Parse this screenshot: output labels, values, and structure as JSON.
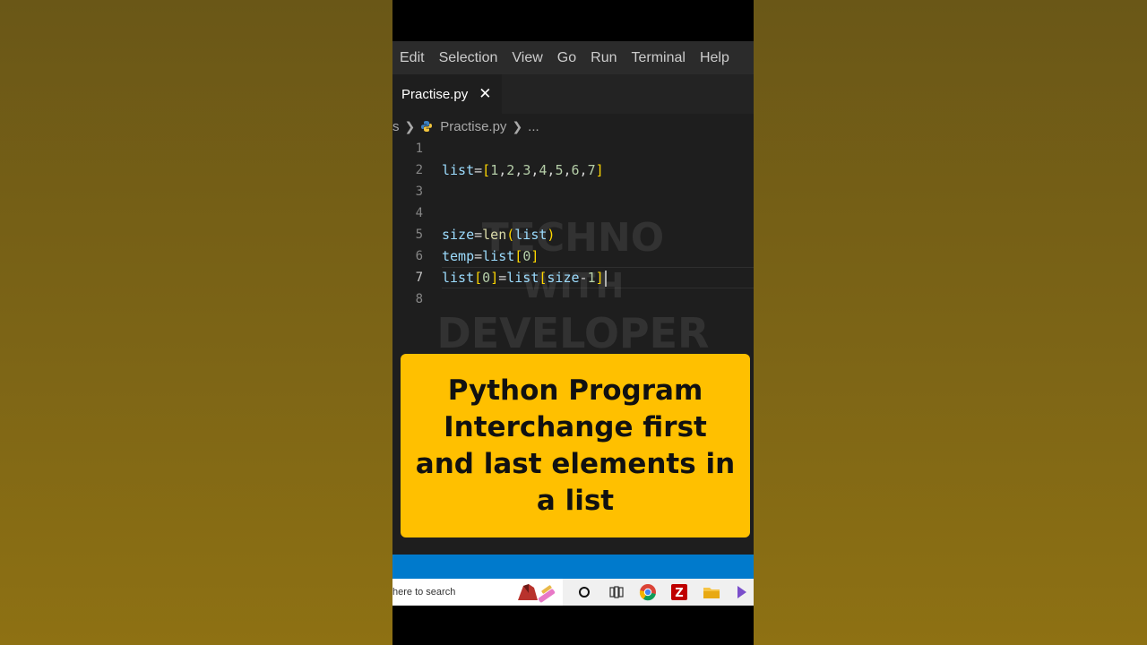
{
  "menu": {
    "items": [
      "Edit",
      "Selection",
      "View",
      "Go",
      "Run",
      "Terminal",
      "Help"
    ]
  },
  "tab": {
    "label": "Practise.py",
    "close_glyph": "✕"
  },
  "breadcrumb": {
    "prefix": "s",
    "file": "Practise.py",
    "ellipsis": "..."
  },
  "editor": {
    "line_numbers": [
      "1",
      "2",
      "3",
      "4",
      "5",
      "6",
      "7",
      "8"
    ],
    "active_line": "7",
    "lines": [
      "",
      "list=[1,2,3,4,5,6,7]",
      "",
      "",
      "size=len(list)",
      "temp=list[0]",
      "list[0]=list[size-1]",
      ""
    ]
  },
  "watermark": {
    "line1": "TECHNO",
    "line2": "WITH",
    "line3": "DEVELOPER"
  },
  "banner": {
    "line1": "Python Program",
    "line2": "Interchange first",
    "line3": "and last elements in",
    "line4": "a list"
  },
  "taskbar": {
    "search_placeholder": "here to search",
    "icons": [
      "search-art-icon",
      "cortana-circle-icon",
      "task-view-icon",
      "chrome-icon",
      "filezilla-icon",
      "file-explorer-icon",
      "app-icon"
    ]
  },
  "colors": {
    "menubar": "#2b2b2b",
    "editor_bg": "#1e1e1e",
    "banner": "#ffc000",
    "statusbar": "#007acc",
    "bracket_gold": "#ffd700",
    "bracket_purple": "#da70d6"
  }
}
